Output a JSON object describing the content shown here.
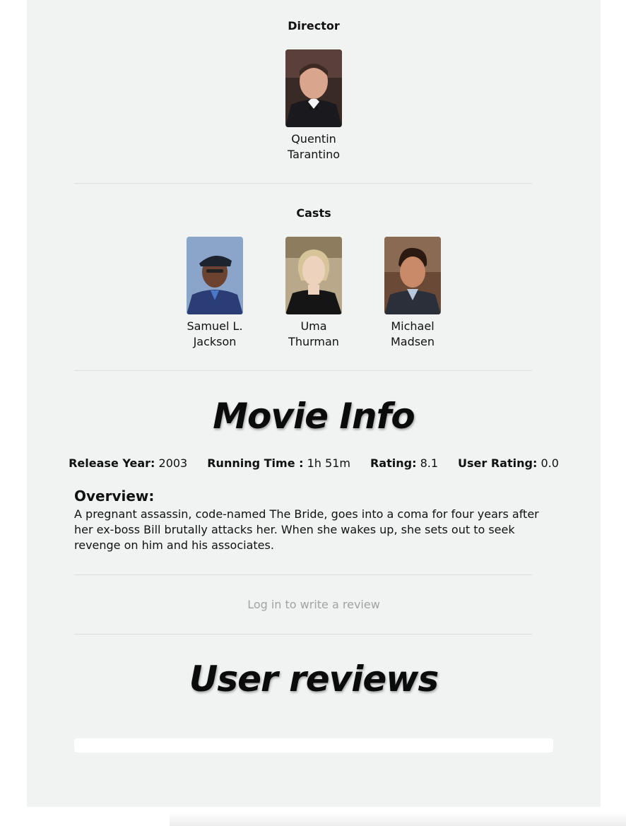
{
  "director": {
    "heading": "Director",
    "people": [
      {
        "name": "Quentin Tarantino"
      }
    ]
  },
  "casts": {
    "heading": "Casts",
    "people": [
      {
        "name": "Samuel L. Jackson"
      },
      {
        "name": "Uma Thurman"
      },
      {
        "name": "Michael Madsen"
      }
    ]
  },
  "movie_info": {
    "heading": "Movie Info",
    "release_year_label": "Release Year:",
    "release_year_value": "2003",
    "running_time_label": "Running Time :",
    "running_time_value": "1h 51m",
    "rating_label": "Rating:",
    "rating_value": "8.1",
    "user_rating_label": "User Rating:",
    "user_rating_value": "0.0",
    "overview_label": "Overview:",
    "overview_text": "A pregnant assassin, code-named The Bride, goes into a coma for four years after her ex-boss Bill brutally attacks her. When she wakes up, she sets out to seek revenge on him and his associates."
  },
  "review": {
    "login_prompt": "Log in to write a review"
  },
  "user_reviews": {
    "heading": "User reviews"
  },
  "colors": {
    "panel_background": "#f1f2f2",
    "muted_link": "#a3a3a3",
    "divider": "#dcdcdc"
  }
}
